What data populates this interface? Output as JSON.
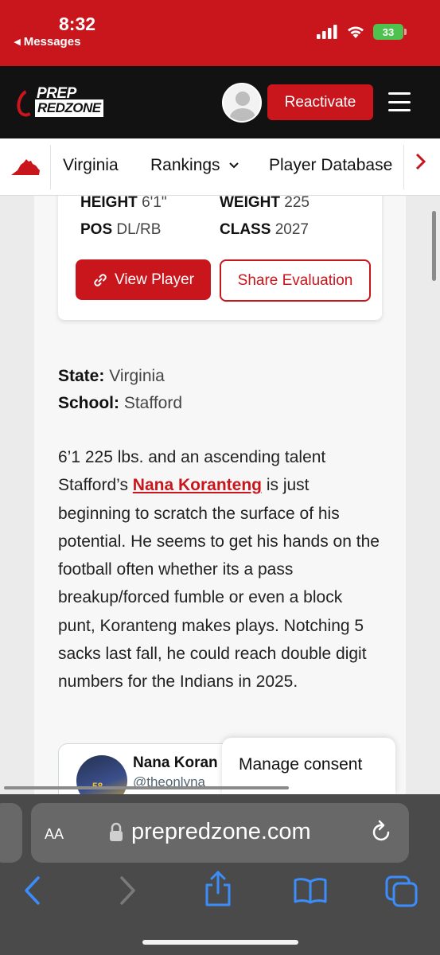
{
  "status_bar": {
    "time": "8:32",
    "back_label": "◂ Messages",
    "battery": "33"
  },
  "header": {
    "logo_line1": "PREP",
    "logo_line2": "REDZONE",
    "reactivate_label": "Reactivate"
  },
  "nav": {
    "items": [
      "Virginia",
      "Rankings",
      "Player Database"
    ]
  },
  "player_card": {
    "height_label": "HEIGHT",
    "height_value": "6'1\"",
    "weight_label": "WEIGHT",
    "weight_value": "225",
    "pos_label": "POS",
    "pos_value": "DL/RB",
    "class_label": "CLASS",
    "class_value": "2027",
    "view_player_label": "View Player",
    "share_label": "Share Evaluation"
  },
  "meta": {
    "state_label": "State:",
    "state_value": "Virginia",
    "school_label": "School:",
    "school_value": "Stafford"
  },
  "article": {
    "before_link": "6’1 225 lbs. and an ascending talent Stafford’s ",
    "link_text": "Nana Koranteng",
    "after_link": " is just beginning to scratch the surface of his potential. He seems to get his hands on the football often whether its a pass breakup/forced fumble or even a block punt, Koranteng makes plays. Notching 5 sacks last fall, he could reach double digit numbers for the Indians in 2025."
  },
  "embed": {
    "name": "Nana Koran",
    "handle": "@theonlyna",
    "jersey": "58"
  },
  "consent": {
    "label": "Manage consent"
  },
  "browser": {
    "aa_label": "AA",
    "url": "prepredzone.com"
  },
  "colors": {
    "brand_red": "#c9161c",
    "header_dark": "#121212",
    "safari_chrome": "#4a4a4a",
    "ios_blue": "#3a8dfa"
  }
}
